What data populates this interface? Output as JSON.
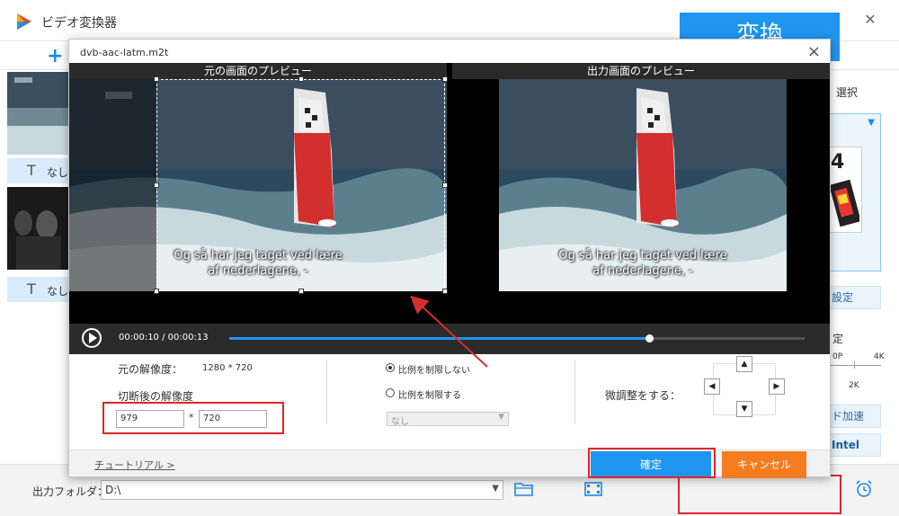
{
  "app": {
    "title": "ビデオ変換器",
    "left_list": [
      {
        "subtitle_label": "なし"
      },
      {
        "subtitle_label": "なし"
      }
    ],
    "right_panel": {
      "select_label": "選択",
      "format_badge": "4",
      "settings_label": "設定",
      "quality_label": "定",
      "quality_ticks": [
        "0P",
        "4K",
        "2K"
      ],
      "accel_label": "ド加速",
      "intel_label": "Intel"
    },
    "output": {
      "label": "出力フォルダ：",
      "path": "D:\\"
    },
    "convert_label": "変換"
  },
  "dialog": {
    "filename": "dvb-aac-latm.m2t",
    "preview_original_label": "元の画面のプレビュー",
    "preview_output_label": "出力画面のプレビュー",
    "subtitle_line1": "Og så har jeg taget ved lære",
    "subtitle_line2": "af nederlagene, -",
    "time_current": "00:00:10",
    "time_separator": "/",
    "time_total": "00:00:13",
    "progress": 0.73,
    "settings": {
      "orig_res_label": "元の解像度：",
      "orig_res_value": "1280 * 720",
      "crop_res_label": "切断後の解像度",
      "crop_width": "979",
      "crop_sep": "*",
      "crop_height": "720",
      "ratio_unlimited": "比例を制限しない",
      "ratio_limited": "比例を制限する",
      "ratio_select": "なし",
      "fine_tune_label": "微調整をする："
    },
    "tutorial_link": "チュートリアル >",
    "ok_label": "確定",
    "cancel_label": "キャンセル"
  },
  "colors": {
    "accent": "#1e96f0",
    "cancel": "#f57c1f",
    "highlight": "#e0242a"
  }
}
